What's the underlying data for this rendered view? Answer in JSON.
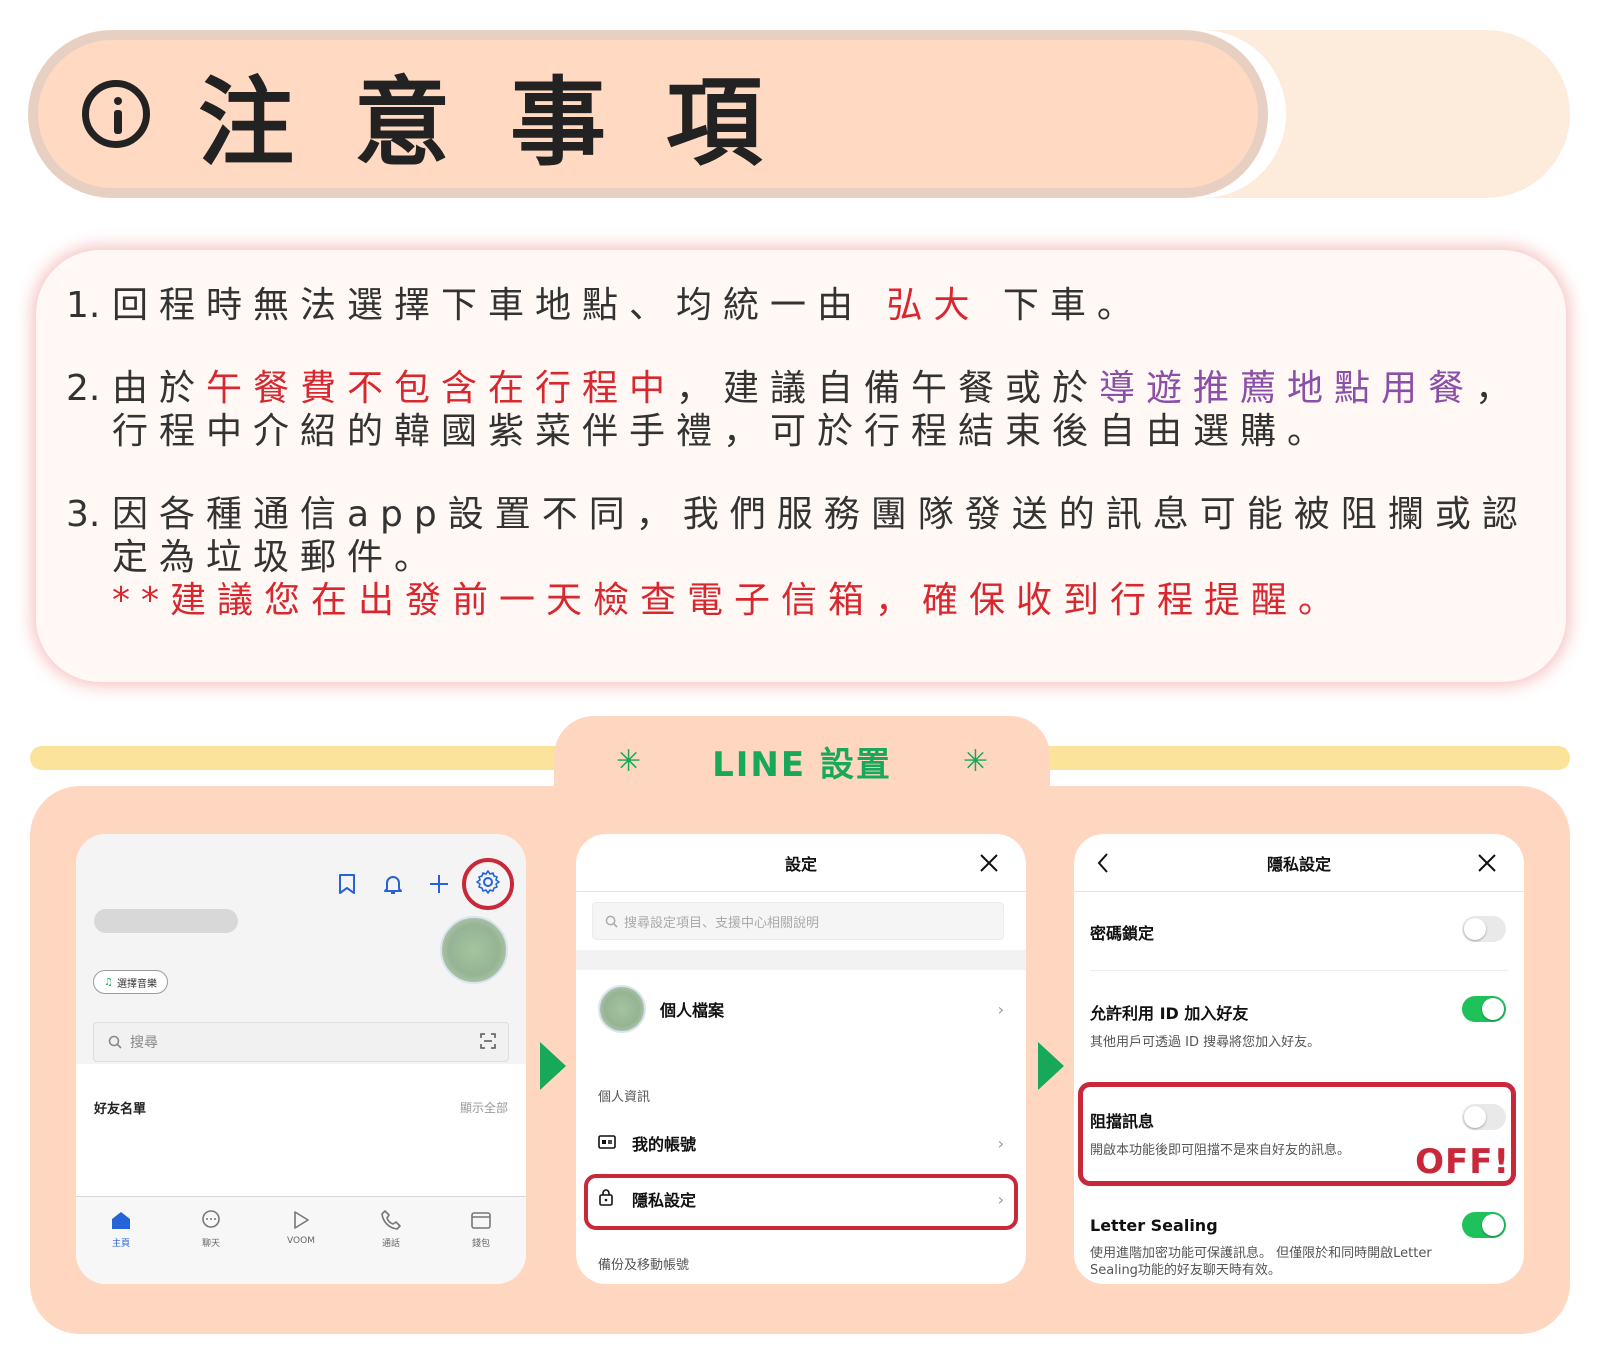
{
  "banner": {
    "title": "注意事項",
    "icon": "info-icon"
  },
  "notes": [
    {
      "num": "1.",
      "lines": [
        [
          {
            "t": "回程時無法選擇下車地點、均統一由 ",
            "c": ""
          },
          {
            "t": "弘大",
            "c": "red"
          },
          {
            "t": " 下車。",
            "c": ""
          }
        ]
      ]
    },
    {
      "num": "2.",
      "lines": [
        [
          {
            "t": "由於",
            "c": ""
          },
          {
            "t": "午餐費不包含在行程中",
            "c": "red"
          },
          {
            "t": "，建議自備午餐或於",
            "c": ""
          },
          {
            "t": "導遊推薦地點用餐",
            "c": "purple"
          },
          {
            "t": "，",
            "c": ""
          }
        ],
        [
          {
            "t": "行程中介紹的韓國紫菜伴手禮，可於行程結束後自由選購。",
            "c": ""
          }
        ]
      ]
    },
    {
      "num": "3.",
      "lines": [
        [
          {
            "t": "因各種通信app設置不同，我們服務團隊發送的訊息可能被阻攔或認",
            "c": ""
          }
        ],
        [
          {
            "t": "定為垃圾郵件。",
            "c": ""
          }
        ],
        [
          {
            "t": "**建議您在出發前一天檢查電子信箱，確保收到行程提醒。",
            "c": "red"
          }
        ]
      ]
    }
  ],
  "line_section": {
    "tab_title": "LINE 設置",
    "tab_star": "✳",
    "colors": {
      "accent": "#17a85a",
      "highlight": "#c8283a",
      "toggle_on": "#1fc25a"
    }
  },
  "phone1": {
    "music_label": "選擇音樂",
    "search_placeholder": "搜尋",
    "friends_label": "好友名單",
    "show_all": "顯示全部",
    "nav": [
      {
        "label": "主頁",
        "icon": "home-icon"
      },
      {
        "label": "聊天",
        "icon": "chat-icon"
      },
      {
        "label": "VOOM",
        "icon": "voom-icon"
      },
      {
        "label": "通話",
        "icon": "phone-icon"
      },
      {
        "label": "錢包",
        "icon": "wallet-icon"
      }
    ]
  },
  "phone2": {
    "title": "設定",
    "search_placeholder": "搜尋設定項目、支援中心相關說明",
    "profile_label": "個人檔案",
    "section_personal": "個人資訊",
    "my_account": "我的帳號",
    "privacy": "隱私設定",
    "section_backup": "備份及移動帳號",
    "chevron": "›"
  },
  "phone3": {
    "title": "隱私設定",
    "back": "‹",
    "items": [
      {
        "title": "密碼鎖定",
        "desc": "",
        "state": "off"
      },
      {
        "title": "允許利用 ID 加入好友",
        "desc": "其他用戶可透過 ID 搜尋將您加入好友。",
        "state": "on"
      },
      {
        "title": "阻擋訊息",
        "desc": "開啟本功能後即可阻擋不是來自好友的訊息。",
        "state": "off"
      },
      {
        "title": "Letter Sealing",
        "desc": "使用進階加密功能可保護訊息。 但僅限於和同時開啟Letter Sealing功能的好友聊天時有效。",
        "state": "on"
      }
    ],
    "off_label": "OFF!"
  }
}
